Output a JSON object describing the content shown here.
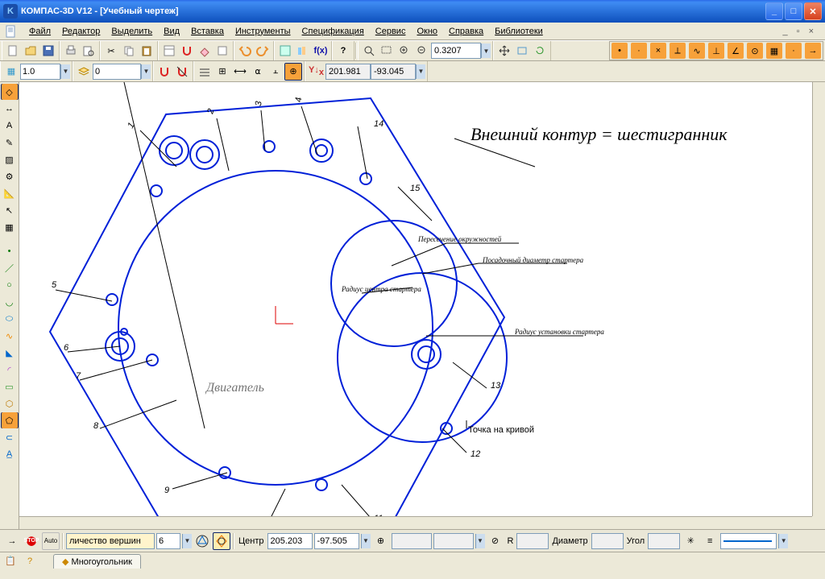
{
  "title": "КОМПАС-3D V12 - [Учебный чертеж]",
  "menu": [
    "Файл",
    "Редактор",
    "Выделить",
    "Вид",
    "Вставка",
    "Инструменты",
    "Спецификация",
    "Сервис",
    "Окно",
    "Справка",
    "Библиотеки"
  ],
  "zoom": "0.3207",
  "row3": {
    "snap": "1.0",
    "layer": "0",
    "coordX": "201.981",
    "coordY": "-93.045"
  },
  "canvas": {
    "title_label": "Внешний контур = шестигранник",
    "label_point": "Точка на кривой",
    "label_engine": "Двигатель",
    "callouts": {
      "c1": "Пересечение окружностей",
      "c2": "Посадочный диаметр стартера",
      "c3": "Радиус центра стартера",
      "c4": "Радиус установки стартера"
    }
  },
  "propbar": {
    "vertices_label": "личество вершин",
    "vertices": "6",
    "center_label": "Центр",
    "cx": "205.203",
    "cy": "-97.505",
    "r_label": "R",
    "r_val": "",
    "diam_label": "Диаметр",
    "diam_val": "",
    "angle_label": "Угол",
    "angle_val": ""
  },
  "tab": "Многоугольник"
}
